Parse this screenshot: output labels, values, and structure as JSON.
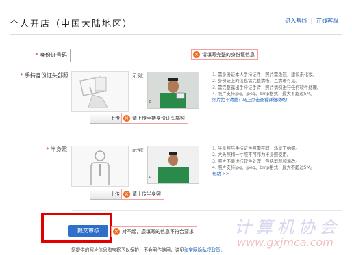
{
  "header": {
    "title": "个人开店（中国大陆地区）",
    "help_link": "进入帮线",
    "divider": "|",
    "service_link": "在线客服"
  },
  "id_number": {
    "label": "身份证号码",
    "value": "",
    "error": "请填写完整的身份证信息"
  },
  "headshot": {
    "label": "手持身份证头部照",
    "example_label": "示例：",
    "upload_label": "上传",
    "error": "请上传手持身份证头部照",
    "notes": [
      "1. 需身份证本人手持证件，照片需免冠，建议未化妆。",
      "2. 身份证上的信息需完整清晰，且清晰可见。",
      "3. 需完整露出手持证手臂，照片请勿进行任何软件处理。",
      "4. 照片支持jpg、jpeg、bmp格式，最大不超过5M。"
    ],
    "notes_link": "照片拍不清楚？马上点击查看详细攻略！"
  },
  "halfbody": {
    "label": "半身照",
    "example_label": "示例：",
    "upload_label": "上传",
    "error": "请上传半身照",
    "notes": [
      "1. 半身照与手持证件照需在同一场景下拍摄。",
      "2. 大头照和一寸照不可作为半身照使用。",
      "3. 照片不能进行软件处理，包括剪裁和涂改。",
      "4. 照片支持jpg、jpeg、bmp格式，最大不超过5M。"
    ],
    "help_link": "帮助 >>"
  },
  "submit": {
    "label": "提交审核",
    "error": "对不起，您填写的信息不符合要求"
  },
  "footer": {
    "text": "您提供的照片信息淘宝将予以保护，不会用作他用，详见",
    "link": "淘宝网隐私权政策",
    "tail": "。"
  },
  "watermark": {
    "cn": "计算机协会",
    "url": "www.gxjmca.com"
  },
  "colors": {
    "accent": "#2e6fc9",
    "error": "#f06a1e",
    "highlight": "#e00000",
    "link": "#1a5fb4"
  }
}
